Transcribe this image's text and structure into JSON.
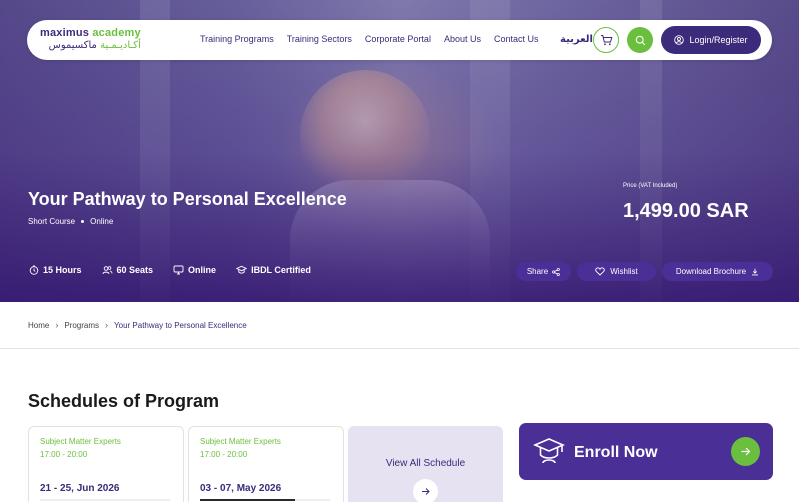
{
  "colors": {
    "brand_purple": "#3c2a7a",
    "button_purple": "#4a2f96",
    "accent_green": "#6bbf3e"
  },
  "header": {
    "logo_en_main": "maximus",
    "logo_en_accent": "academy",
    "logo_ar_accent": "أكـاديـمـية",
    "logo_ar_main": "ماكسيموس",
    "nav": [
      "Training Programs",
      "Training Sectors",
      "Corporate Portal",
      "About Us",
      "Contact Us"
    ],
    "language": "العربية",
    "cart_icon": "cart-icon",
    "search_icon": "search-icon",
    "login_label": "Login/Register"
  },
  "hero": {
    "title": "Your Pathway to Personal Excellence",
    "course_type": "Short Course",
    "delivery": "Online",
    "price_label": "Price (VAT Included)",
    "price": "1,499.00 SAR",
    "meta": {
      "hours": "15 Hours",
      "seats": "60 Seats",
      "mode": "Online",
      "certification": "IBDL Certified"
    },
    "share_label": "Share",
    "wishlist_label": "Wishlist",
    "brochure_label": "Download Brochure"
  },
  "breadcrumb": [
    "Home",
    "Programs",
    "Your Pathway to Personal Excellence"
  ],
  "schedules": {
    "title": "Schedules of Program",
    "cards": [
      {
        "role": "Subject Matter Experts",
        "time": "17:00 - 20:00",
        "date": "21 - 25, Jun 2026"
      },
      {
        "role": "Subject Matter Experts",
        "time": "17:00 - 20:00",
        "date": "03 - 07, May 2026"
      }
    ],
    "view_all_label": "View All Schedule"
  },
  "enroll": {
    "label": "Enroll Now"
  }
}
